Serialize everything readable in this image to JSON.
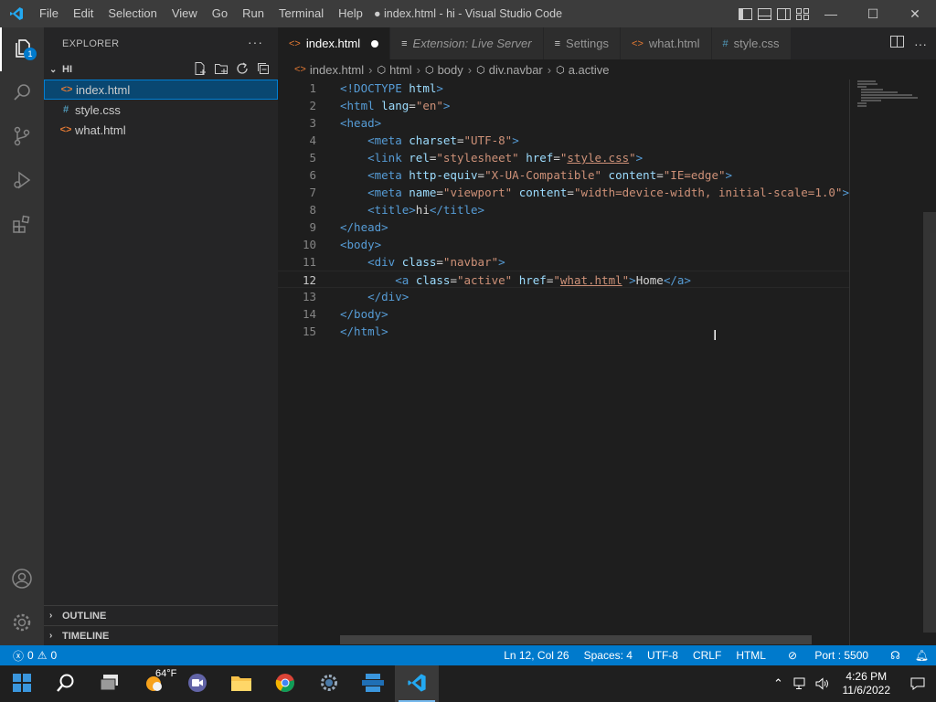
{
  "titlebar": {
    "menu": [
      "File",
      "Edit",
      "Selection",
      "View",
      "Go",
      "Run",
      "Terminal",
      "Help"
    ],
    "title": "● index.html - hi - Visual Studio Code",
    "minimize": "—",
    "maximize": "☐",
    "close": "✕"
  },
  "activity": {
    "explorer_badge": "1"
  },
  "sidebar": {
    "header": "EXPLORER",
    "more": "···",
    "folder": "HI",
    "files": [
      {
        "name": "index.html",
        "icon": "<>"
      },
      {
        "name": "style.css",
        "icon": "#"
      },
      {
        "name": "what.html",
        "icon": "<>"
      }
    ],
    "outline": "OUTLINE",
    "timeline": "TIMELINE"
  },
  "tabs": [
    {
      "label": "index.html",
      "icon": "<>"
    },
    {
      "label": "Extension: Live Server",
      "icon": "≡"
    },
    {
      "label": "Settings",
      "icon": "≡"
    },
    {
      "label": "what.html",
      "icon": "<>"
    },
    {
      "label": "style.css",
      "icon": "#"
    }
  ],
  "breadcrumb": [
    "index.html",
    "html",
    "body",
    "div.navbar",
    "a.active"
  ],
  "code": {
    "line_numbers": [
      "1",
      "2",
      "3",
      "4",
      "5",
      "6",
      "7",
      "8",
      "9",
      "10",
      "11",
      "12",
      "13",
      "14",
      "15"
    ],
    "current_line": 12
  },
  "status": {
    "errors": "0",
    "warnings": "0",
    "position": "Ln 12, Col 26",
    "spaces": "Spaces: 4",
    "encoding": "UTF-8",
    "eol": "CRLF",
    "language": "HTML",
    "port": "Port : 5500"
  },
  "taskbar": {
    "weather": "64°F",
    "time": "4:26 PM",
    "date": "11/6/2022"
  },
  "colors": {
    "accent": "#007acc",
    "html_icon": "#e37933",
    "css_icon": "#519aba"
  }
}
